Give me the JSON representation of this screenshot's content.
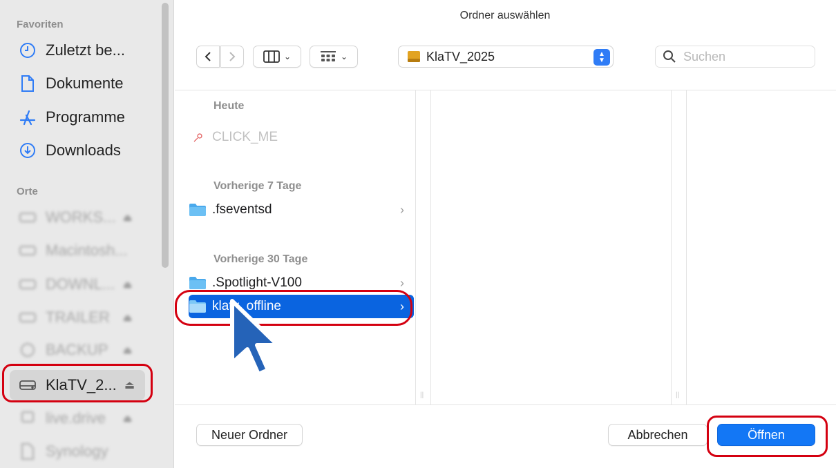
{
  "window": {
    "title": "Ordner auswählen"
  },
  "colors": {
    "accent": "#1377f5",
    "selection": "#0a64e0",
    "highlight": "#d40010",
    "folder": "#4aa9ec"
  },
  "sidebar": {
    "favorites_heading": "Favoriten",
    "favorites": [
      {
        "label": "Zuletzt be...",
        "icon": "clock-icon"
      },
      {
        "label": "Dokumente",
        "icon": "document-icon"
      },
      {
        "label": "Programme",
        "icon": "apps-icon"
      },
      {
        "label": "Downloads",
        "icon": "download-icon"
      }
    ],
    "locations_heading": "Orte",
    "locations": [
      {
        "label": "WORKS...",
        "icon": "drive-icon"
      },
      {
        "label": "Macintosh...",
        "icon": "drive-icon"
      },
      {
        "label": "DOWNL...",
        "icon": "drive-icon"
      },
      {
        "label": "TRAILER",
        "icon": "drive-icon"
      },
      {
        "label": "BACKUP",
        "icon": "time-machine-icon"
      },
      {
        "label": "KlaTV_2...",
        "icon": "drive-icon"
      },
      {
        "label": "live.drive",
        "icon": "network-drive-icon"
      },
      {
        "label": "Synology",
        "icon": "document-icon"
      }
    ]
  },
  "toolbar": {
    "back_icon": "chevron-left-icon",
    "forward_icon": "chevron-right-icon",
    "view_icon": "columns-view-icon",
    "group_icon": "grid-group-icon",
    "location_label": "KlaTV_2025",
    "search_placeholder": "Suchen"
  },
  "browser": {
    "groups": [
      {
        "heading": "Heute",
        "items": [
          {
            "name": "CLICK_ME",
            "kind": "alias",
            "disabled": true
          }
        ]
      },
      {
        "heading": "Vorherige 7 Tage",
        "items": [
          {
            "name": ".fseventsd",
            "kind": "folder"
          }
        ]
      },
      {
        "heading": "Vorherige 30 Tage",
        "items": [
          {
            "name": ".Spotlight-V100",
            "kind": "folder"
          },
          {
            "name": "klatv_offline",
            "kind": "folder",
            "selected": true
          }
        ]
      }
    ]
  },
  "footer": {
    "new_folder": "Neuer Ordner",
    "cancel": "Abbrechen",
    "open": "Öffnen"
  }
}
